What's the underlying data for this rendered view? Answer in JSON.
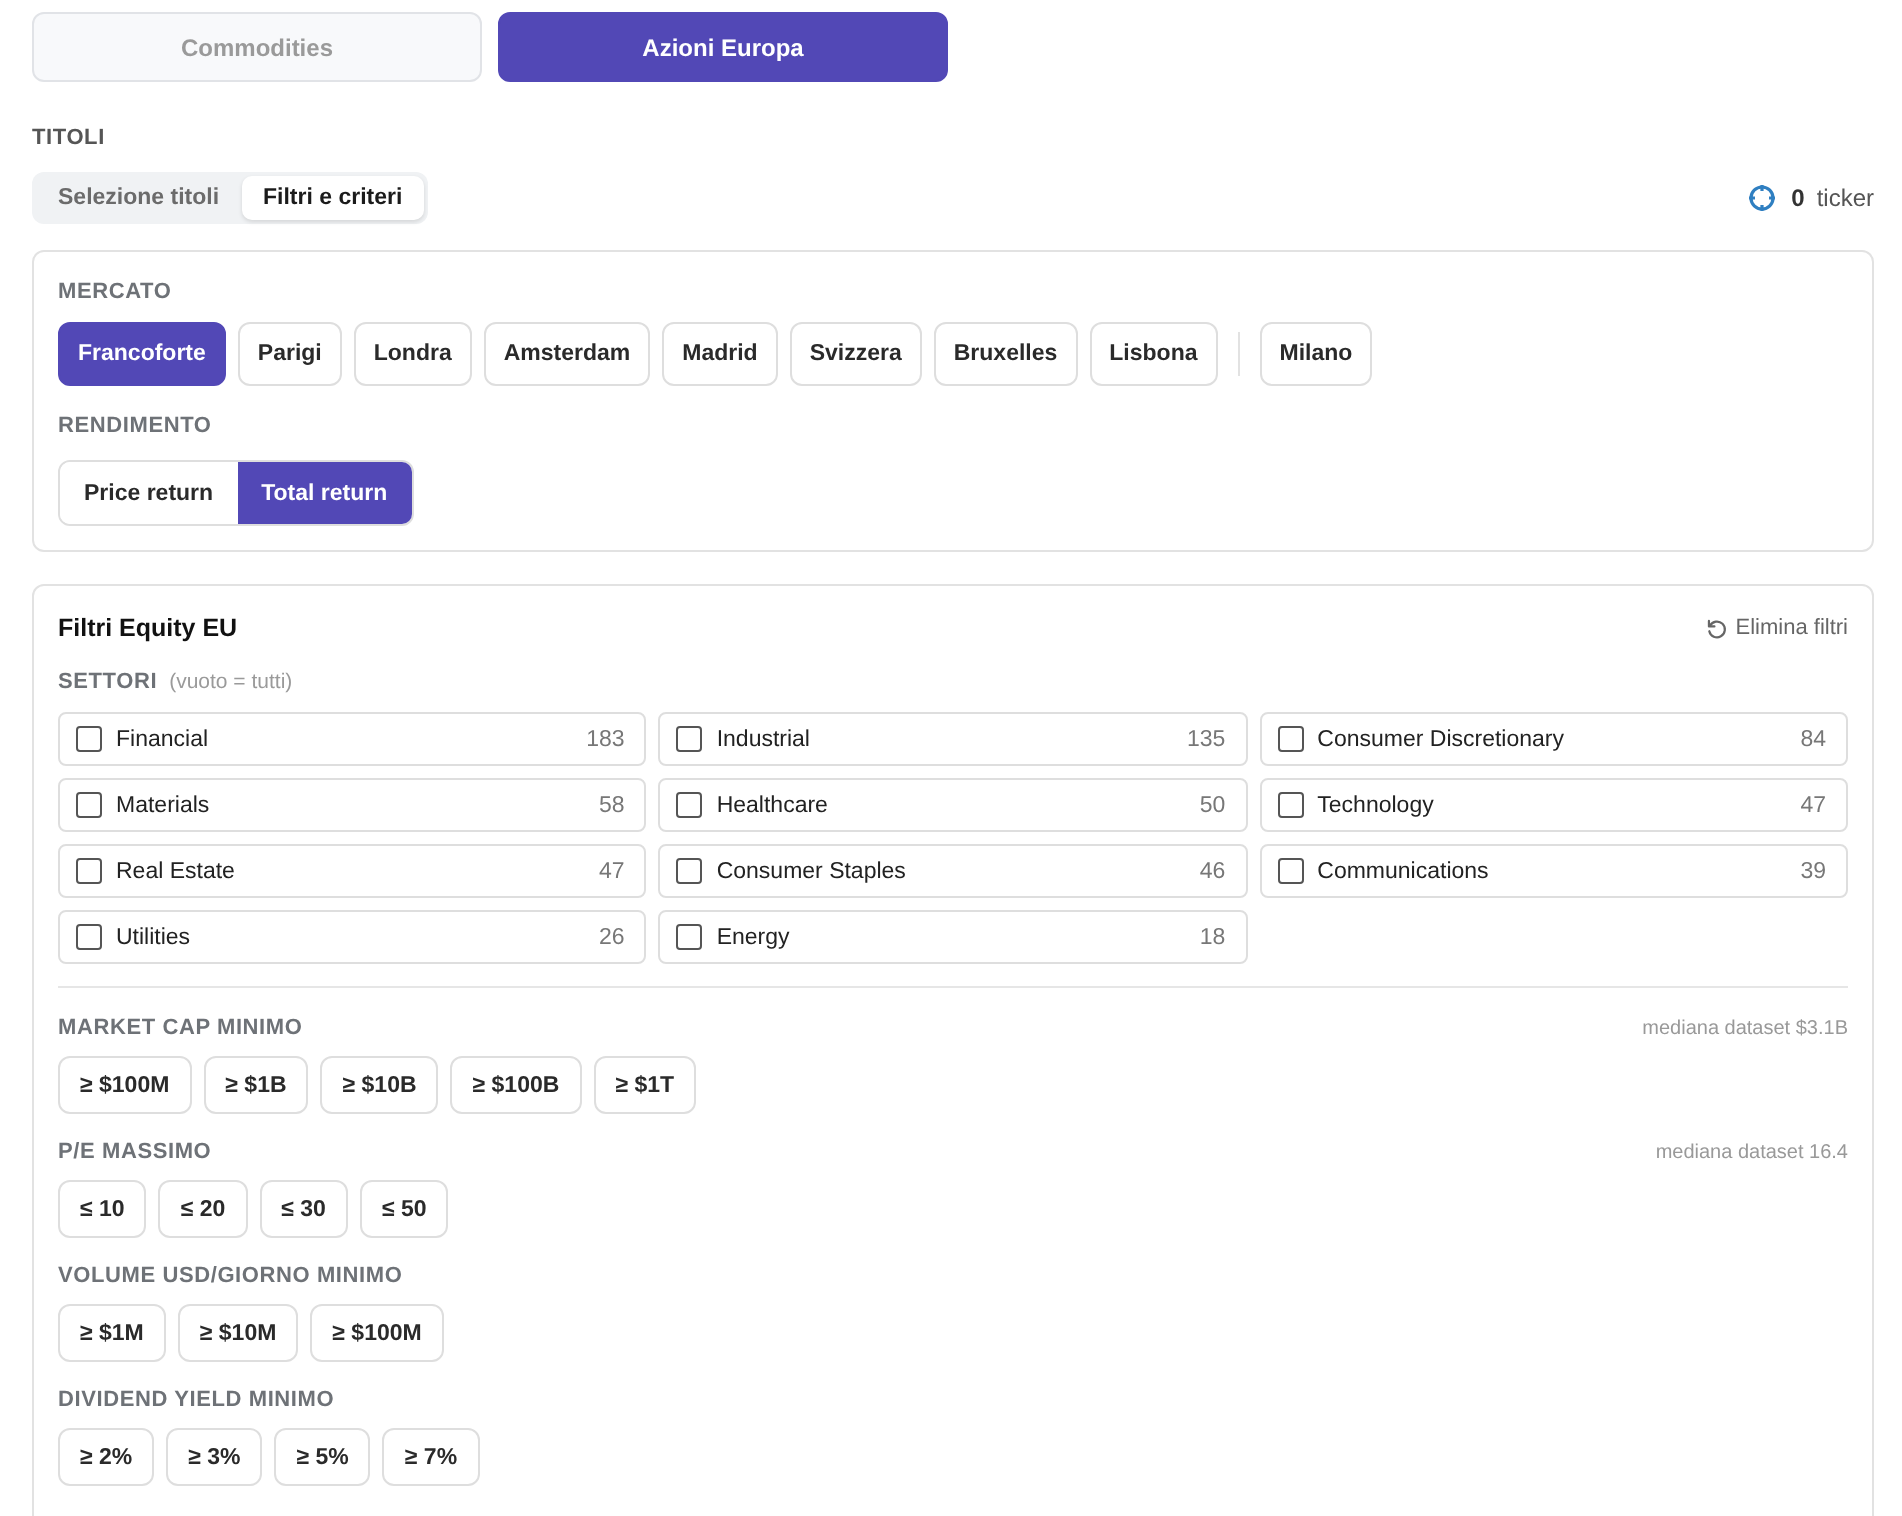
{
  "asset_tabs": [
    {
      "label": "Commodities",
      "selected": false
    },
    {
      "label": "Azioni Europa",
      "selected": true
    }
  ],
  "titoli": {
    "heading": "TITOLI",
    "mode_tabs": [
      {
        "label": "Selezione titoli",
        "selected": false
      },
      {
        "label": "Filtri e criteri",
        "selected": true
      }
    ],
    "ticker_count": {
      "count": "0",
      "label": "ticker"
    }
  },
  "market_card": {
    "market": {
      "heading": "MERCATO",
      "option_groups": [
        {
          "options": [
            {
              "label": "Francoforte",
              "selected": true
            },
            {
              "label": "Parigi",
              "selected": false
            },
            {
              "label": "Londra",
              "selected": false
            },
            {
              "label": "Amsterdam",
              "selected": false
            },
            {
              "label": "Madrid",
              "selected": false
            },
            {
              "label": "Svizzera",
              "selected": false
            },
            {
              "label": "Bruxelles",
              "selected": false
            },
            {
              "label": "Lisbona",
              "selected": false
            }
          ]
        },
        {
          "options": [
            {
              "label": "Milano",
              "selected": false
            }
          ]
        }
      ]
    },
    "return": {
      "heading": "RENDIMENTO",
      "options": [
        {
          "label": "Price return",
          "selected": false
        },
        {
          "label": "Total return",
          "selected": true
        }
      ]
    }
  },
  "filters": {
    "title": "Filtri Equity EU",
    "reset": "Elimina filtri",
    "sectors": {
      "heading": "SETTORI",
      "hint": "(vuoto = tutti)",
      "items": [
        {
          "label": "Financial",
          "count": "183",
          "checked": false
        },
        {
          "label": "Industrial",
          "count": "135",
          "checked": false
        },
        {
          "label": "Consumer Discretionary",
          "count": "84",
          "checked": false
        },
        {
          "label": "Materials",
          "count": "58",
          "checked": false
        },
        {
          "label": "Healthcare",
          "count": "50",
          "checked": false
        },
        {
          "label": "Technology",
          "count": "47",
          "checked": false
        },
        {
          "label": "Real Estate",
          "count": "47",
          "checked": false
        },
        {
          "label": "Consumer Staples",
          "count": "46",
          "checked": false
        },
        {
          "label": "Communications",
          "count": "39",
          "checked": false
        },
        {
          "label": "Utilities",
          "count": "26",
          "checked": false
        },
        {
          "label": "Energy",
          "count": "18",
          "checked": false
        }
      ]
    },
    "groups": [
      {
        "heading": "MARKET CAP MINIMO",
        "note": "mediana dataset $3.1B",
        "options": [
          {
            "label": "≥ $100M",
            "selected": false
          },
          {
            "label": "≥ $1B",
            "selected": false
          },
          {
            "label": "≥ $10B",
            "selected": false
          },
          {
            "label": "≥ $100B",
            "selected": false
          },
          {
            "label": "≥ $1T",
            "selected": false
          }
        ]
      },
      {
        "heading": "P/E MASSIMO",
        "note": "mediana dataset 16.4",
        "options": [
          {
            "label": "≤ 10",
            "selected": false
          },
          {
            "label": "≤ 20",
            "selected": false
          },
          {
            "label": "≤ 30",
            "selected": false
          },
          {
            "label": "≤ 50",
            "selected": false
          }
        ]
      },
      {
        "heading": "VOLUME USD/GIORNO MINIMO",
        "options": [
          {
            "label": "≥ $1M",
            "selected": false
          },
          {
            "label": "≥ $10M",
            "selected": false
          },
          {
            "label": "≥ $100M",
            "selected": false
          }
        ]
      },
      {
        "heading": "DIVIDEND YIELD MINIMO",
        "options": [
          {
            "label": "≥ 2%",
            "selected": false
          },
          {
            "label": "≥ 3%",
            "selected": false
          },
          {
            "label": "≥ 5%",
            "selected": false
          },
          {
            "label": "≥ 7%",
            "selected": false
          }
        ]
      }
    ]
  }
}
